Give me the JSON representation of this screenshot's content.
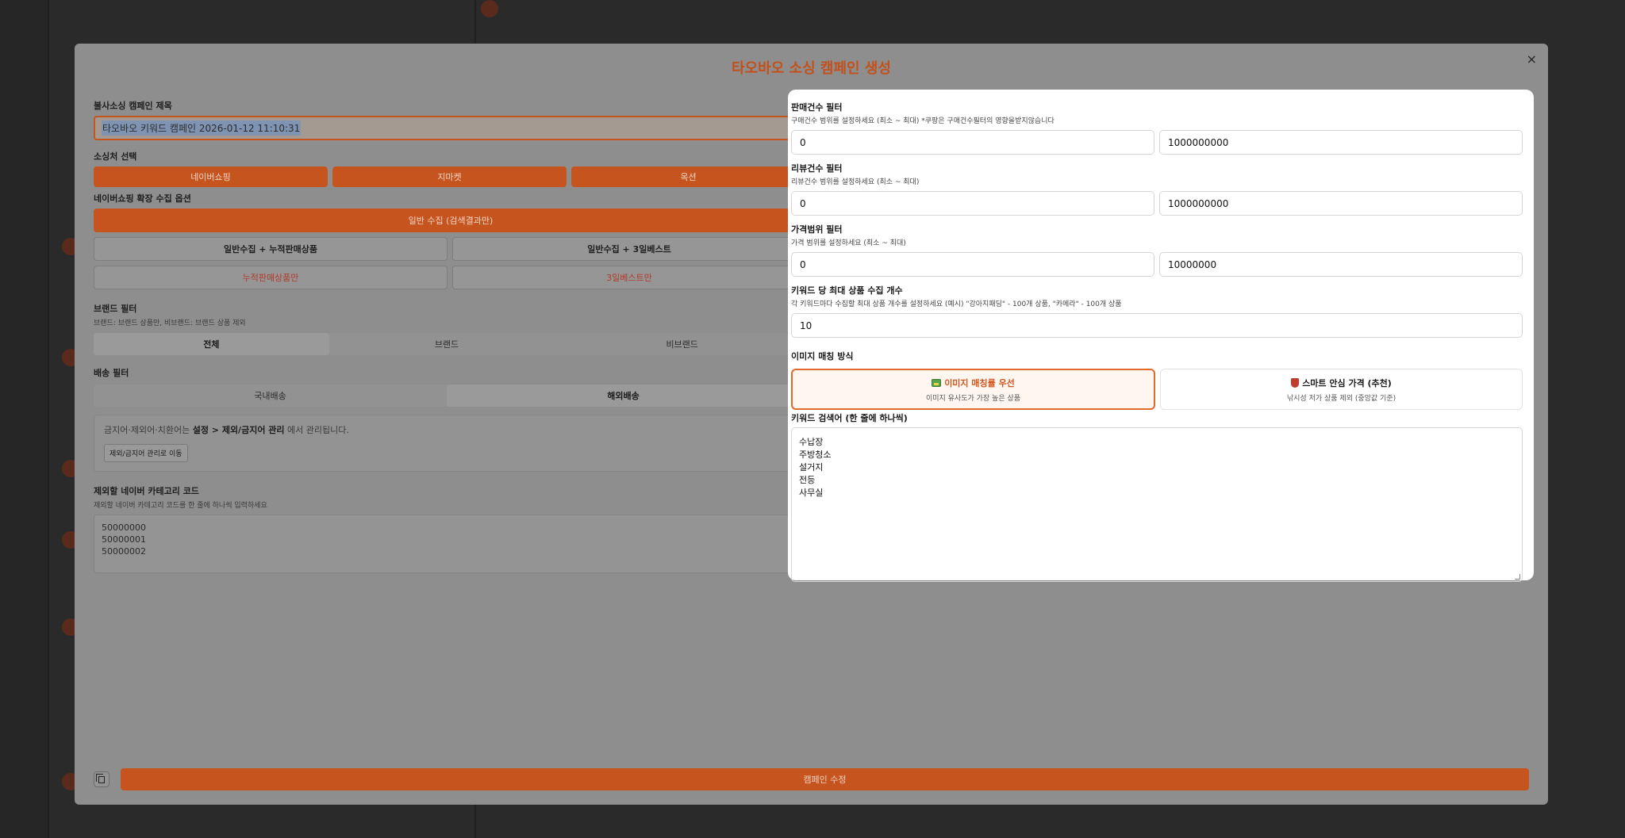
{
  "modal": {
    "title": "타오바오 소싱 캠페인 생성",
    "close": "×",
    "submit_label": "캠페인 수정"
  },
  "left": {
    "campaign_title_label": "불사소싱 캠페인 제목",
    "campaign_title_value": "타오바오 키워드 캠페인 2026-01-12 11:10:31",
    "source_label": "소싱처 선택",
    "sources": [
      "네이버쇼핑",
      "지마켓",
      "옥션"
    ],
    "naver_options_label": "네이버쇼핑 확장 수집 옵션",
    "naver_main_option": "일반 수집 (검색결과만)",
    "naver_options": [
      "일반수집 + 누적판매상품",
      "일반수집 + 3일베스트"
    ],
    "naver_options_only": [
      "누적판매상품만",
      "3일베스트만"
    ],
    "brand_label": "브랜드 필터",
    "brand_sub": "브랜드: 브랜드 상품만, 비브랜드: 브랜드 상품 제외",
    "brand_options": [
      "전체",
      "브랜드",
      "비브랜드"
    ],
    "shipping_label": "배송 필터",
    "shipping_options": [
      "국내배송",
      "해외배송"
    ],
    "notice_prefix": "금지어·제외어·치환어는",
    "notice_bold": "설정 > 제외/금지어 관리",
    "notice_suffix": "에서 관리됩니다.",
    "notice_button": "제외/금지어 관리로 이동",
    "category_label": "제외할 네이버 카테고리 코드",
    "category_sub": "제외할 네이버 카테고리 코드를 한 줄에 하나씩 입력하세요",
    "category_codes": [
      "50000000",
      "50000001",
      "50000002"
    ]
  },
  "panel": {
    "sales_label": "판매건수 필터",
    "sales_sub": "구매건수 범위를 설정하세요 (최소 ~ 최대) *쿠팡은 구매건수필터의 영향을받지않습니다",
    "sales_min": "0",
    "sales_max": "1000000000",
    "review_label": "리뷰건수 필터",
    "review_sub": "리뷰건수 범위를 설정하세요 (최소 ~ 최대)",
    "review_min": "0",
    "review_max": "1000000000",
    "price_label": "가격범위 필터",
    "price_sub": "가격 범위를 설정하세요 (최소 ~ 최대)",
    "price_min": "0",
    "price_max": "10000000",
    "max_label": "키워드 당 최대 상품 수집 개수",
    "max_sub": "각 키워드마다 수집할 최대 상품 개수를 설정하세요 (예시) \"강아지패딩\" - 100개 상품, \"카메라\" - 100개 상품",
    "max_value": "10",
    "match_label": "이미지 매칭 방식",
    "match_options": [
      {
        "title": "이미지 매칭률 우선",
        "sub": "이미지 유사도가 가장 높은 상품",
        "icon": "image-icon"
      },
      {
        "title": "스마트 안심 가격 (추천)",
        "sub": "낚시성 저가 상품 제외 (중앙값 기준)",
        "icon": "shield-icon"
      }
    ],
    "keywords_label": "키워드 검색어 (한 줄에 하나씩)",
    "keywords": [
      "수납장",
      "주방청소",
      "설거지",
      "전등",
      "사무실"
    ]
  }
}
